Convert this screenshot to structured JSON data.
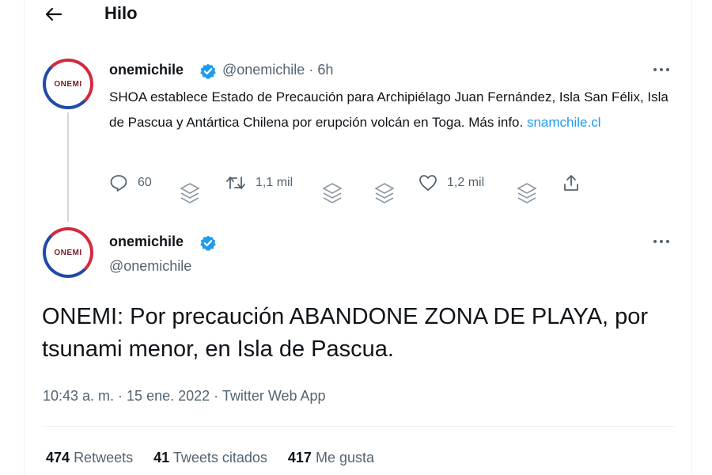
{
  "header": {
    "title": "Hilo"
  },
  "colors": {
    "link": "#1d9bf0",
    "verified": "#1d9bf0",
    "secondary_text": "#536471"
  },
  "tweet1": {
    "avatar_text": "ONEMI",
    "name": "onemichile",
    "handle_time": "@onemichile · 6h",
    "text_before_link": "SHOA establece Estado de Precaución para Archipiélago Juan Fernández, Isla San Félix, Isla de Pascua y Antártica Chilena por erupción volcán en Toga. Más info. ",
    "link": "snamchile.cl",
    "actions": {
      "replies": "60",
      "retweets": "1,1 mil",
      "likes": "1,2 mil"
    }
  },
  "tweet2": {
    "avatar_text": "ONEMI",
    "name": "onemichile",
    "handle": "@onemichile",
    "text": "ONEMI: Por precaución ABANDONE ZONA DE PLAYA, por tsunami menor, en Isla de Pascua.",
    "meta": "10:43 a. m. · 15 ene. 2022 · Twitter Web App",
    "stats": [
      {
        "count": "474",
        "label": "Retweets"
      },
      {
        "count": "41",
        "label": "Tweets citados"
      },
      {
        "count": "417",
        "label": "Me gusta"
      }
    ]
  }
}
